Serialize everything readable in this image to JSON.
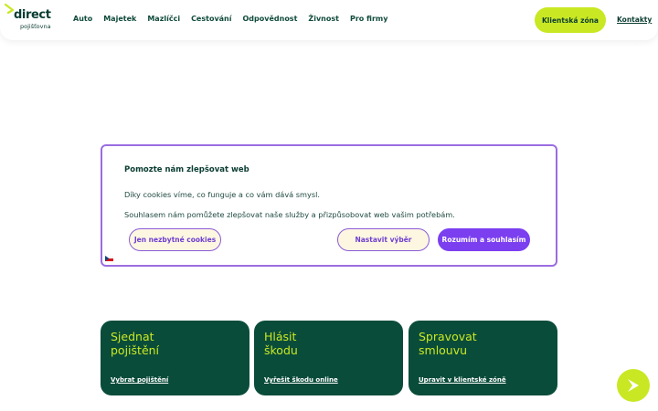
{
  "header": {
    "logo": {
      "word": "direct",
      "sub": "pojišťovna"
    },
    "nav": [
      "Auto",
      "Majetek",
      "Mazlíčci",
      "Cestování",
      "Odpovědnost",
      "Živnost",
      "Pro firmy"
    ],
    "client_zone": "Klientská zóna",
    "contacts": "Kontakty"
  },
  "cookie": {
    "title": "Pomozte nám zlepšovat web",
    "p1": "Díky cookies víme, co funguje a co vám dává smysl.",
    "p2": "Souhlasem nám pomůžete zlepšovat naše služby a přizpůsobovat web vašim potřebám.",
    "btn_necessary": "Jen nezbytné cookies",
    "btn_settings": "Nastavit výběr",
    "btn_accept": "Rozumím a souhlasím",
    "flag_icon": "czech-flag-icon"
  },
  "cards": [
    {
      "title_line1": "Sjednat",
      "title_line2": "pojištění",
      "link": "Vybrat pojištění"
    },
    {
      "title_line1": "Hlásit",
      "title_line2": "škodu",
      "link": "Vyřešit škodu online"
    },
    {
      "title_line1": "Spravovat",
      "title_line2": "smlouvu",
      "link": "Upravit v klientské zóně"
    }
  ],
  "fab_icon": "arrow-chevron-icon",
  "colors": {
    "accent_lime": "#c9e823",
    "dark_green": "#0a4c3a",
    "purple": "#7b3ff0",
    "cream": "#fdf7e2"
  }
}
